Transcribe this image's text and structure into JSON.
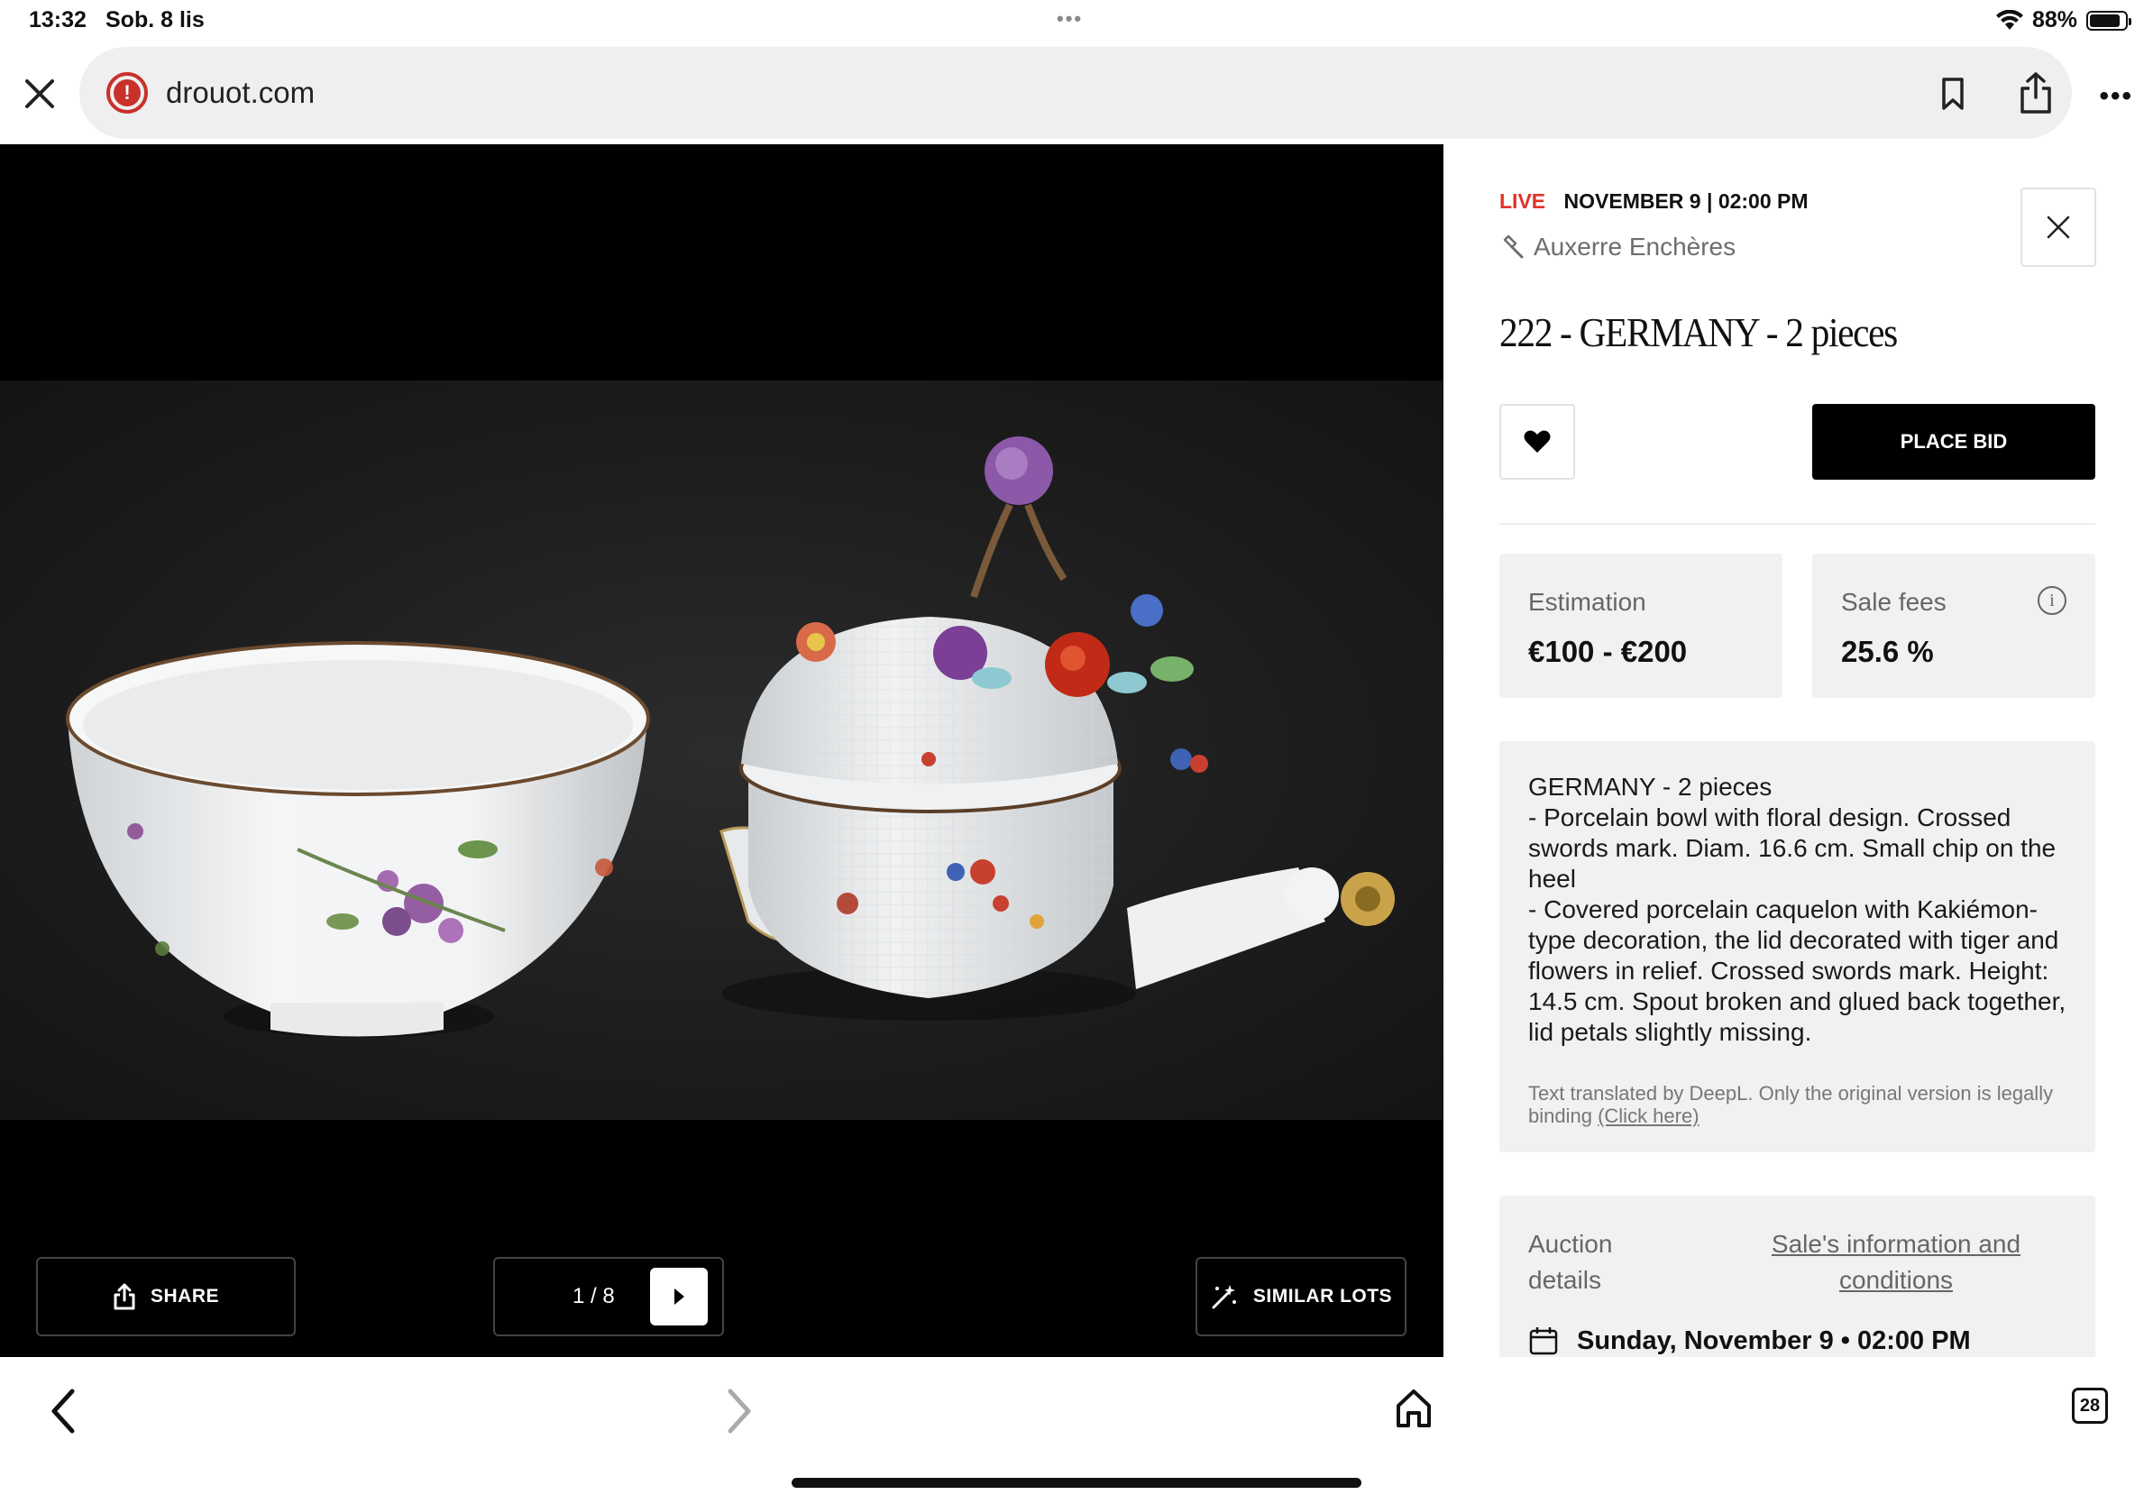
{
  "status_bar": {
    "time": "13:32",
    "date": "Sob. 8 lis",
    "battery": "88%",
    "battery_level": 0.88
  },
  "browser": {
    "url": "drouot.com"
  },
  "viewer": {
    "share_label": "SHARE",
    "pager": "1 / 8",
    "similar_label": "SIMILAR LOTS"
  },
  "lot": {
    "live_label": "LIVE",
    "datetime": "NOVEMBER 9 | 02:00 PM",
    "auction_house": "Auxerre Enchères",
    "title": "222 - GERMANY - 2 pieces",
    "bid_label": "PLACE BID",
    "estimation_label": "Estimation",
    "estimation_value": "€100 - €200",
    "fees_label": "Sale fees",
    "fees_value": "25.6 %",
    "description": "GERMANY - 2 pieces\n- Porcelain bowl with floral design. Crossed swords mark. Diam. 16.6 cm. Small chip on the heel\n- Covered porcelain caquelon with Kakiémon-type decoration, the lid decorated with tiger and flowers in relief. Crossed swords mark. Height: 14.5 cm. Spout broken and glued back together, lid petals slightly missing.",
    "deepl_note": "Text translated by DeepL. Only the original version is legally binding",
    "deepl_link": "(Click here)",
    "auction_details_label": "Auction details",
    "sale_info_link": "Sale's information and conditions",
    "auction_date": "Sunday, November 9 • 02:00 PM"
  },
  "bottom_bar": {
    "tabs_count": "28"
  },
  "colors": {
    "live_red": "#e0332a",
    "warning_red": "#c8322b",
    "panel_box": "#f1f1f1"
  }
}
